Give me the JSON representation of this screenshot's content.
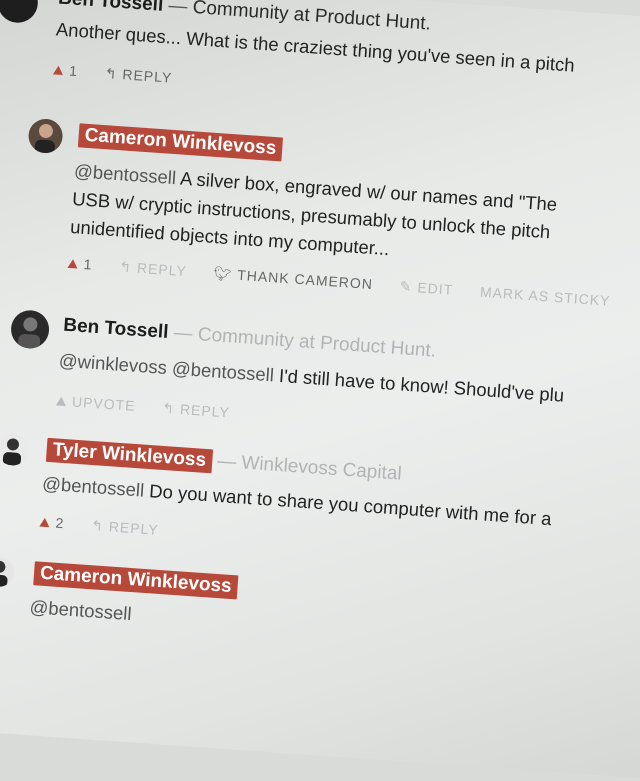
{
  "comments": [
    {
      "name": "Ben Tossell",
      "separator": " — ",
      "org": "Community at Product Hunt.",
      "text": "Another ques... What is the craziest thing you've seen in a pitch",
      "upvotes": "1",
      "reply": "REPLY"
    },
    {
      "name": "Cameron Winklevoss",
      "mention": "@bentossell",
      "lines": [
        " A silver box, engraved w/ our names and \"The",
        "USB w/ cryptic instructions, presumably to unlock the pitch",
        "unidentified objects into my computer..."
      ],
      "upvotes": "1",
      "reply": "REPLY",
      "thank": "THANK CAMERON",
      "edit": "EDIT",
      "sticky": "MARK AS STICKY"
    },
    {
      "name": "Ben Tossell",
      "separator": " — ",
      "org": "Community at Product Hunt.",
      "mention1": "@winklevoss",
      "mention2": " @bentossell",
      "text": " I'd still have to know! Should've plu",
      "upvote": "UPVOTE",
      "reply": "REPLY"
    },
    {
      "name": "Tyler Winklevoss",
      "separator": " — ",
      "org": "Winklevoss Capital",
      "mention": "@bentossell",
      "text": " Do you want to share you computer with me for a",
      "upvotes": "2",
      "reply": "REPLY"
    },
    {
      "name": "Cameron Winklevoss",
      "mention": "@bentossell"
    }
  ]
}
